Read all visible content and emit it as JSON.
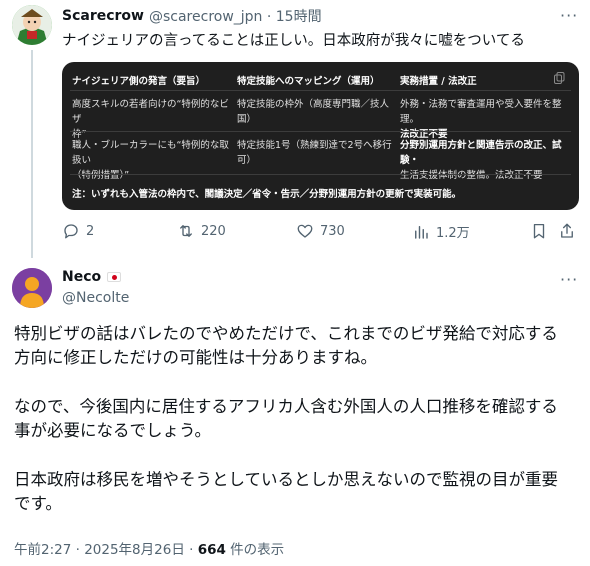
{
  "tweet1": {
    "name": "Scarecrow",
    "handle_time": "@scarecrow_jpn · 15時間",
    "more": "···",
    "text": "ナイジェリアの言ってることは正しい。日本政府が我々に嘘をついてる",
    "card": {
      "headers": [
        "ナイジェリア側の発言（要旨）",
        "特定技能へのマッピング（運用）",
        "実務措置 / 法改正"
      ],
      "rows": [
        {
          "c1": [
            "高度スキルの若者向けの“特例的なビザ",
            "枠”"
          ],
          "c2": [
            "特定技能の枠外（高度専門職／技人",
            "国）"
          ],
          "c3": [
            "外務・法務で審査運用や受入要件を整理。",
            "法改正不要"
          ]
        },
        {
          "c1": [
            "職人・ブルーカラーにも“特例的な取扱い",
            "（特例措置）”"
          ],
          "c2": [
            "特定技能1号（熟練到達で2号へ移行",
            "可）"
          ],
          "c3": [
            "分野別運用方針と関連告示の改正、試験・",
            "生活支援体制の整備。法改正不要"
          ]
        }
      ],
      "note": "注：いずれも入管法の枠内で、閣議決定／省令・告示／分野別運用方針の更新で実装可能。"
    },
    "actions": {
      "reply": "2",
      "retweet": "220",
      "like": "730",
      "views": "1.2万"
    }
  },
  "tweet2": {
    "name": "Neco",
    "handle": "@Necolte",
    "more": "···",
    "paragraphs": [
      [
        "特別ビザの話はバレたのでやめただけで、これまでのビザ発給で対応する",
        "方向に修正しただけの可能性は十分ありますね。"
      ],
      [
        "なので、今後国内に居住するアフリカ人含む外国人の人口推移を確認する",
        "事が必要になるでしょう。"
      ],
      [
        "日本政府は移民を増やそうとしているとしか思えないので監視の目が重要",
        "です。"
      ]
    ],
    "timestamp": "午前2:27 · 2025年8月26日 · ",
    "views_count": "664",
    "views_label": " 件の表示"
  },
  "colors": {
    "text_primary": "#0f1419",
    "text_secondary": "#536471",
    "card_bg": "#1f1f1f",
    "thread_line": "#cfd9de"
  }
}
